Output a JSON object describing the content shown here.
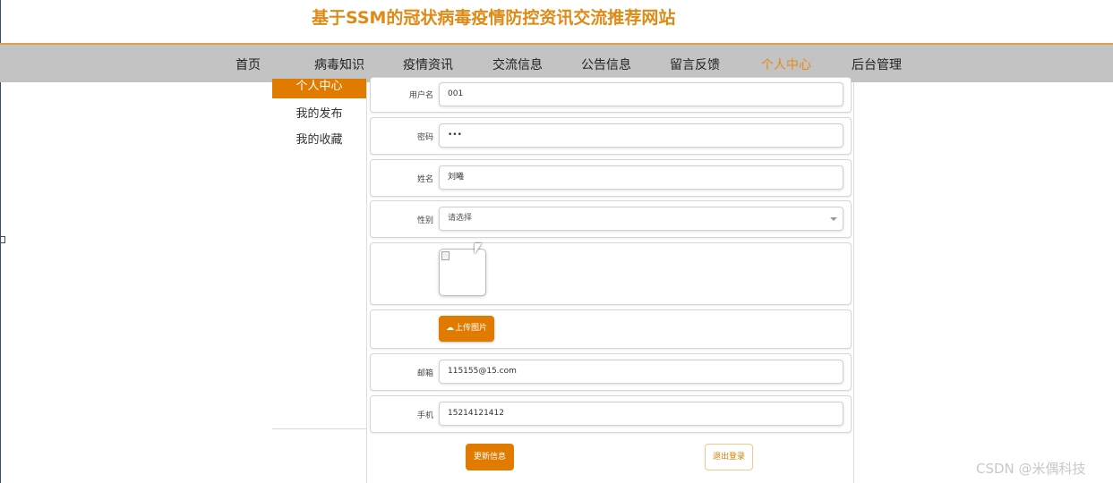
{
  "site": {
    "title": "基于SSM的冠状病毒疫情防控资讯交流推荐网站"
  },
  "nav": {
    "items": [
      "首页",
      "病毒知识",
      "疫情资讯",
      "交流信息",
      "公告信息",
      "留言反馈",
      "个人中心",
      "后台管理"
    ],
    "active": "个人中心",
    "accent_color": "#e58a12"
  },
  "sidebar": {
    "items": [
      "个人中心",
      "我的发布",
      "我的收藏"
    ],
    "active_color": "#e07b00"
  },
  "form": {
    "username": {
      "label": "用户名",
      "value": "001"
    },
    "password": {
      "label": "密码",
      "value": "•••"
    },
    "name": {
      "label": "姓名",
      "value": "刘曦"
    },
    "gender": {
      "label": "性别",
      "value": "请选择"
    },
    "upload_label": "上传图片",
    "email": {
      "label": "邮箱",
      "value": "115155@15.com"
    },
    "phone": {
      "label": "手机",
      "value": "15214121412"
    }
  },
  "actions": {
    "update": "更新信息",
    "logout": "退出登录"
  },
  "icons": {
    "upload": "cloud-upload-icon",
    "select": "chevron-down-icon"
  },
  "watermark": "CSDN @米偶科技"
}
